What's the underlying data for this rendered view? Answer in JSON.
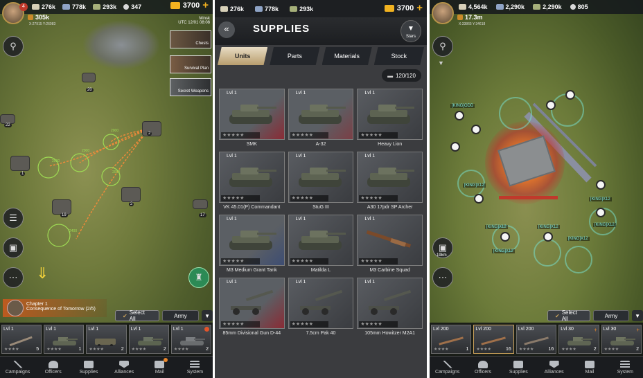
{
  "left": {
    "resources": {
      "steel": "276k",
      "iron": "778k",
      "oil": "293k",
      "misc": "347",
      "gold": "3700"
    },
    "player": {
      "level": "4",
      "power": "305k",
      "coords": "X:27915 Y:26083"
    },
    "location": {
      "city": "Minsk",
      "time": "UTC 12/01 08:08"
    },
    "side_items": [
      "Chests",
      "Survival Plan",
      "Secret Weapons"
    ],
    "chapter": {
      "title": "Chapter 1",
      "subtitle": "Consequence of Tomorrow (2/5)"
    },
    "buttons": {
      "select_all": "Select All",
      "army": "Army"
    },
    "units": [
      {
        "lvl": "Lvl 1",
        "count": "5"
      },
      {
        "lvl": "Lvl 1",
        "count": "1"
      },
      {
        "lvl": "Lvl 1",
        "count": "2"
      },
      {
        "lvl": "Lvl 1",
        "count": "2"
      },
      {
        "lvl": "Lvl 1",
        "count": "2"
      }
    ],
    "nav": [
      "Campaigns",
      "Officers",
      "Supplies",
      "Alliances",
      "Mail",
      "System"
    ],
    "map_nums": [
      "22",
      "20",
      "1",
      "2",
      "19",
      "17",
      "2"
    ],
    "stats": [
      "2000",
      "2000",
      "2000",
      "2000",
      "2400"
    ]
  },
  "middle": {
    "resources": {
      "steel": "276k",
      "iron": "778k",
      "oil": "293k",
      "gold": "3700"
    },
    "title": "SUPPLIES",
    "stars_label": "Stars",
    "tabs": [
      "Units",
      "Parts",
      "Materials",
      "Stock"
    ],
    "capacity": "120/120",
    "items": [
      {
        "lvl": "Lvl 1",
        "name": "SMK",
        "bg": "red"
      },
      {
        "lvl": "Lvl 1",
        "name": "A-32",
        "bg": "red2"
      },
      {
        "lvl": "Lvl 1",
        "name": "Heavy Lion",
        "bg": "grey"
      },
      {
        "lvl": "Lvl 1",
        "name": "VK 45.01(P) Commandant",
        "bg": "grey"
      },
      {
        "lvl": "Lvl 1",
        "name": "StuG III",
        "bg": "grey"
      },
      {
        "lvl": "Lvl 1",
        "name": "A30 17pdr SP Archer",
        "bg": "grey"
      },
      {
        "lvl": "Lvl 1",
        "name": "M3 Medium Grant Tank",
        "bg": "blue"
      },
      {
        "lvl": "Lvl 1",
        "name": "Matilda L",
        "bg": "grey"
      },
      {
        "lvl": "Lvl 1",
        "name": "M3 Carbine Squad",
        "bg": "grey"
      },
      {
        "lvl": "Lvl 1",
        "name": "85mm Divisional Gun D-44",
        "bg": "red"
      },
      {
        "lvl": "Lvl 1",
        "name": "7.5cm Pak 40",
        "bg": "grey"
      },
      {
        "lvl": "Lvl 1",
        "name": "105mm Howitzer M2A1",
        "bg": "grey"
      }
    ]
  },
  "right": {
    "resources": {
      "steel": "4,564k",
      "iron": "2,290k",
      "oil": "2,290k",
      "misc": "805"
    },
    "player": {
      "power": "17.3m",
      "coords": "X:33865 Y:34618"
    },
    "tags": [
      "[KING]ODD",
      "[KING]X12",
      "[KING]X12",
      "[KING]X12",
      "[KING]X12",
      "[KING]X12",
      "[KING]X12",
      "[KING]X12"
    ],
    "buttons": {
      "select_all": "Select All",
      "army": "Army"
    },
    "units": [
      {
        "lvl": "Lvl 200",
        "count": "1"
      },
      {
        "lvl": "Lvl 200",
        "count": "16"
      },
      {
        "lvl": "Lvl 200",
        "count": "16"
      },
      {
        "lvl": "Lvl 30",
        "count": "2"
      },
      {
        "lvl": "Lvl 30",
        "count": "2"
      }
    ],
    "nav": [
      "Campaigns",
      "Officers",
      "Supplies",
      "Alliances",
      "Mail",
      "System"
    ],
    "dist": "19km"
  },
  "colors": {
    "accent": "#c9a15a",
    "gold": "#f2b220",
    "teal": "#7fe8e0"
  }
}
